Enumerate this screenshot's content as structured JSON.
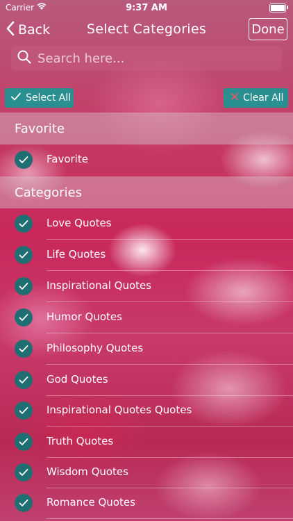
{
  "status_bar": {
    "carrier": "Carrier",
    "time": "9:37 AM"
  },
  "nav": {
    "back_label": "Back",
    "title": "Select Categories",
    "done_label": "Done"
  },
  "search": {
    "placeholder": "Search here...",
    "value": ""
  },
  "actions": {
    "select_all": "Select All",
    "clear_all": "Clear All"
  },
  "sections": {
    "favorite": {
      "header": "Favorite",
      "items": [
        "Favorite"
      ]
    },
    "categories": {
      "header": "Categories",
      "items": [
        "Love Quotes",
        "Life Quotes",
        "Inspirational Quotes",
        "Humor Quotes",
        "Philosophy Quotes",
        "God Quotes",
        "Inspirational Quotes Quotes",
        "Truth Quotes",
        "Wisdom Quotes",
        "Romance Quotes"
      ]
    }
  },
  "colors": {
    "accent": "#2a8f90",
    "check_bg": "#1f6f72",
    "clear_icon": "#e8566a"
  },
  "icons": [
    "chevron-left-icon",
    "search-icon",
    "checkmark-icon",
    "close-icon",
    "wifi-icon",
    "battery-icon"
  ]
}
